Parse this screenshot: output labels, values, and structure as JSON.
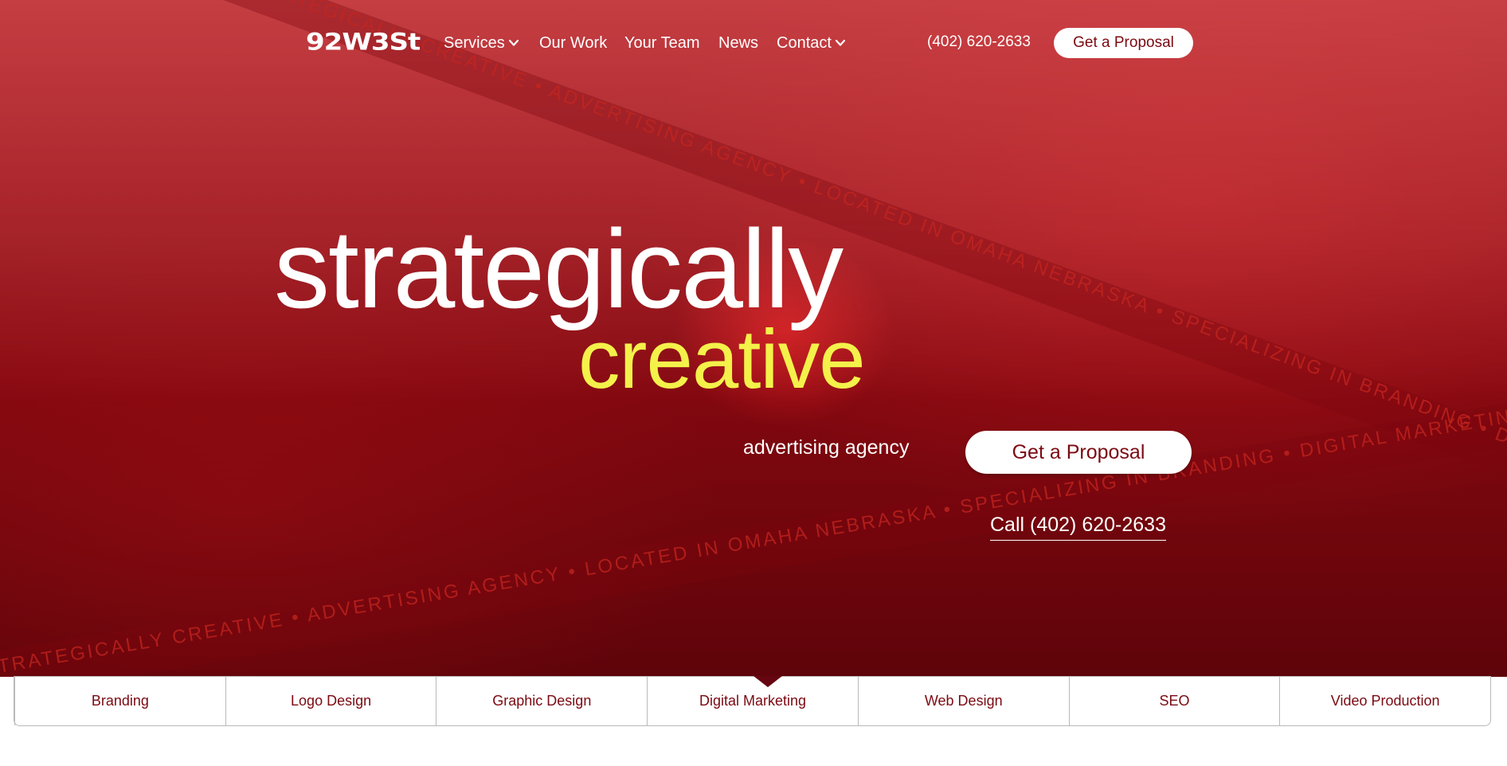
{
  "nav": {
    "logo": "92W3St",
    "items": [
      {
        "label": "Services",
        "has_dropdown": true
      },
      {
        "label": "Our Work",
        "has_dropdown": false
      },
      {
        "label": "Your Team",
        "has_dropdown": false
      },
      {
        "label": "News",
        "has_dropdown": false
      },
      {
        "label": "Contact",
        "has_dropdown": true
      }
    ],
    "phone": "(402) 620-2633",
    "cta": "Get a Proposal"
  },
  "hero": {
    "headline_1": "strategically",
    "headline_2": "creative",
    "tagline": "advertising agency",
    "cta": "Get a Proposal",
    "call": "Call (402) 620-2633",
    "ribbon_text": "STRATEGICALLY CREATIVE • ADVERTISING AGENCY • LOCATED IN OMAHA NEBRASKA • SPECIALIZING IN BRANDING • DIGITAL MARKETING • GRAPHIC DESIGN"
  },
  "services_tabs": [
    {
      "label": "Branding"
    },
    {
      "label": "Logo Design"
    },
    {
      "label": "Graphic Design"
    },
    {
      "label": "Digital Marketing"
    },
    {
      "label": "Web Design"
    },
    {
      "label": "SEO"
    },
    {
      "label": "Video Production"
    }
  ],
  "colors": {
    "hero_red": "#8f0810",
    "accent_yellow": "#f4f14a",
    "brand_maroon": "#7b0a12",
    "white": "#ffffff"
  }
}
